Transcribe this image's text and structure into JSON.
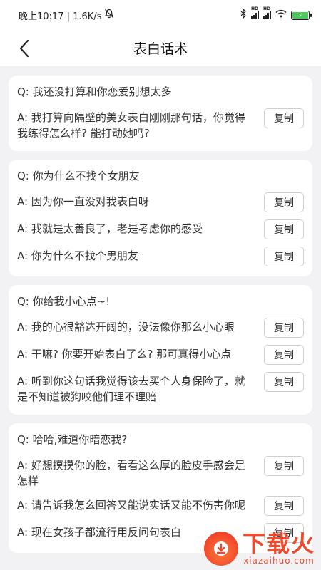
{
  "status_bar": {
    "time_speed": "晚上10:17 | 1.6K/s",
    "battery_color": "#4cc95b"
  },
  "nav": {
    "title": "表白话术"
  },
  "cards": [
    {
      "question": "Q: 我还没打算和你恋爱别想太多",
      "answers": [
        {
          "text": "A: 我打算向隔壁的美女表白刚刚那句话，你觉得我练得怎么样? 能打动她吗?",
          "copy_label": "复制"
        }
      ]
    },
    {
      "question": "Q: 你为什么不找个女朋友",
      "answers": [
        {
          "text": "A: 因为你一直没对我表白呀",
          "copy_label": "复制"
        },
        {
          "text": "A: 我就是太善良了，老是考虑你的感受",
          "copy_label": "复制"
        },
        {
          "text": "A: 你为什么不找个男朋友",
          "copy_label": "复制"
        }
      ]
    },
    {
      "question": "Q: 你给我小心点~!",
      "answers": [
        {
          "text": "A: 我的心很豁达开阔的，没法像你那么小心眼",
          "copy_label": "复制"
        },
        {
          "text": "A: 干嘛? 你要开始表白了么? 那可真得小心点",
          "copy_label": "复制"
        },
        {
          "text": "A: 听到你这句话我觉得该去买个人身保险了，就是不知道被狗咬他们理不理赔",
          "copy_label": "复制"
        }
      ]
    },
    {
      "question": "Q: 哈哈,难道你暗恋我?",
      "answers": [
        {
          "text": "A: 好想摸摸你的脸，看看这么厚的脸皮手感会是怎样",
          "copy_label": "复制"
        },
        {
          "text": "A: 请告诉我怎么回答又能说实话又能不伤害你呢",
          "copy_label": "复制"
        },
        {
          "text": "A: 现在女孩子都流行用反问句表白",
          "copy_label": "复制"
        }
      ]
    }
  ],
  "watermark": {
    "title": "下载火",
    "subtitle": "xiazaihuo.com"
  }
}
